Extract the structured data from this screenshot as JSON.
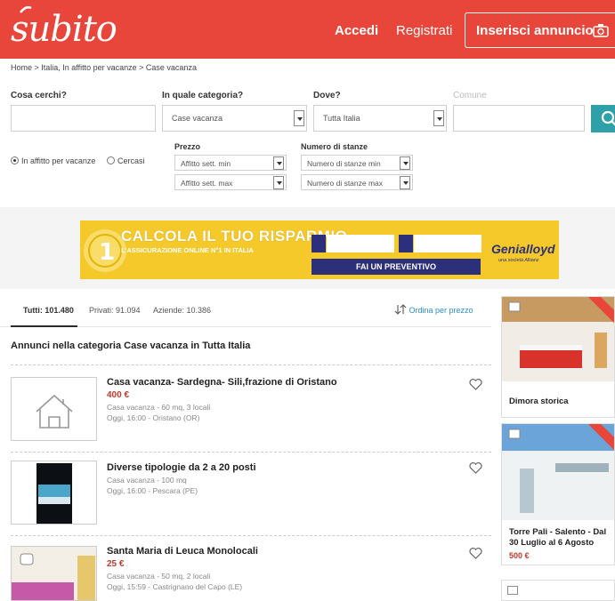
{
  "header": {
    "logo": "subito",
    "login": "Accedi",
    "register": "Registrati",
    "post_ad": "Inserisci annuncio"
  },
  "breadcrumb": "Home > Italia, In affitto per vacanze > Case vacanza",
  "search": {
    "what_label": "Cosa cerchi?",
    "category_label": "In quale categoria?",
    "category_value": "Case vacanza",
    "where_label": "Dove?",
    "where_value": "Tutta Italia",
    "comune_label": "Comune",
    "type_rent": "In affitto per vacanze",
    "type_wanted": "Cercasi",
    "price_label": "Prezzo",
    "price_min": "Affitto sett. min",
    "price_max": "Affitto sett. max",
    "rooms_label": "Numero di stanze",
    "rooms_min": "Numero di stanze min",
    "rooms_max": "Numero di stanze max"
  },
  "banner": {
    "title": "CALCOLA IL TUO RISPARMIO",
    "subtitle": "L'ASSICURAZIONE ONLINE N°1 IN ITALIA",
    "cta": "FAI UN PREVENTIVO",
    "brand": "Genialloyd",
    "brand_sub": "una società Allianz"
  },
  "tabs": {
    "all": "Tutti: 101.480",
    "private": "Privati: 91.094",
    "companies": "Aziende: 10.386"
  },
  "sort_label": "Ordina per prezzo",
  "section_title": "Annunci nella categoria Case vacanza in Tutta Italia",
  "listings": [
    {
      "title": "Casa vacanza- Sardegna- Sili,frazione di Oristano",
      "price": "400 €",
      "details": "Casa vacanza - 60 mq, 3 locali",
      "posted": "Oggi, 16:00 - Oristano (OR)"
    },
    {
      "title": "Diverse tipologie da 2 a 20 posti",
      "price": "",
      "details": "Casa vacanza - 100 mq",
      "posted": "Oggi, 16:00 - Pescara (PE)"
    },
    {
      "title": "Santa Maria di Leuca Monolocali",
      "price": "25 €",
      "details": "Casa vacanza - 50 mq, 2 locali",
      "posted": "Oggi, 15:59 - Castrignano del Capo (LE)"
    }
  ],
  "sidebar_cards": [
    {
      "title": "Dimora storica",
      "price": ""
    },
    {
      "title": "Torre Pali - Salento - Dal 30 Luglio al 6 Agosto",
      "price": "500 €"
    }
  ],
  "colors": {
    "brand": "#e8463a",
    "price": "#c0392b",
    "search": "#2da0a8"
  }
}
